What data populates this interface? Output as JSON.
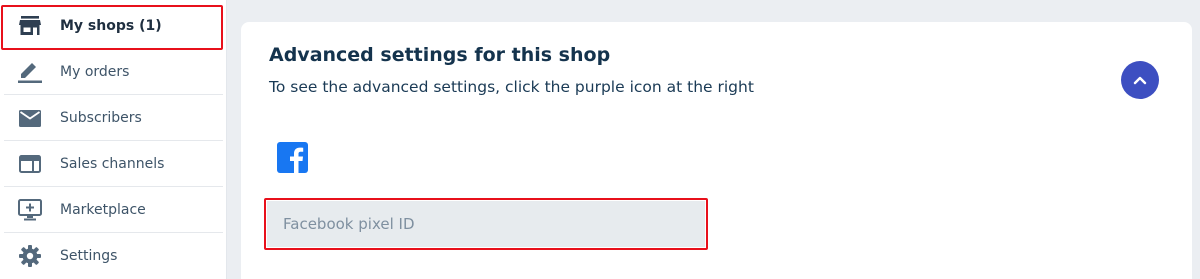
{
  "sidebar": {
    "items": [
      {
        "label": "My shops (1)",
        "icon": "store-icon",
        "active": true
      },
      {
        "label": "My orders",
        "icon": "pencil-icon",
        "active": false
      },
      {
        "label": "Subscribers",
        "icon": "envelope-icon",
        "active": false
      },
      {
        "label": "Sales channels",
        "icon": "browser-window-icon",
        "active": false
      },
      {
        "label": "Marketplace",
        "icon": "monitor-plus-icon",
        "active": false
      },
      {
        "label": "Settings",
        "icon": "gear-icon",
        "active": false
      }
    ]
  },
  "advanced": {
    "title": "Advanced settings for this shop",
    "subtitle": "To see the advanced settings, click the purple icon at the right",
    "collapse_icon": "chevron-up-icon",
    "facebook_icon": "facebook-icon",
    "pixel_placeholder": "Facebook pixel ID",
    "pixel_value": ""
  },
  "colors": {
    "accent_purple": "#3d4fc1",
    "facebook_blue": "#1877f2",
    "highlight_red": "#e8101b",
    "page_background": "#ebeef2"
  }
}
